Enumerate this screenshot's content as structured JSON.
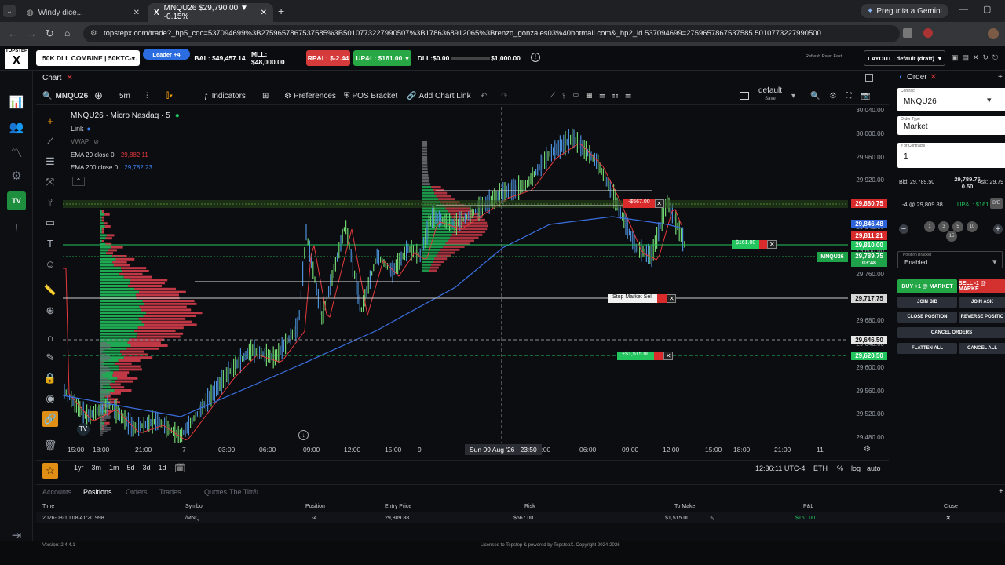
{
  "browser": {
    "tabs": [
      {
        "title": "Windy dice..."
      },
      {
        "title": "MNQU26 $29,790.00 ▼ -0.15%"
      }
    ],
    "gemini": "Pregunta a Gemini",
    "url": "topstepx.com/trade?_hp5_cdc=537094699%3B2759657867537585%3B5010773227990507%3B1786368912065%3Brenzo_gonzales03%40hotmail.com&_hp2_id.537094699=2759657867537585.5010773227990500"
  },
  "app": {
    "logo": "TOPSTEP",
    "account": "50K DLL COMBINE | 50KTC-...",
    "leader": "Leader +4",
    "bal": "BAL: $49,457.14",
    "mll": "MLL: $48,000.00",
    "rpl": "RP&L: $-2.44",
    "upl": "UP&L: $161.00",
    "dll": "DLL:$0.00",
    "dll_max": "$1,000.00",
    "refresh": "Refresh Rate: Fast",
    "layout": "LAYOUT | default (draft)"
  },
  "chart": {
    "panel_title": "Chart",
    "symbol": "MNQU26",
    "interval": "5m",
    "indicators": "Indicators",
    "preferences": "Preferences",
    "pos_bracket": "POS Bracket",
    "add_chart_link": "Add Chart Link",
    "template": "default",
    "template_sub": "Save",
    "legend_title": "MNQU26 · Micro Nasdaq · 5",
    "legend_link": "Link",
    "legend_vwap": "VWAP",
    "ema20_label": "EMA 20 close 0",
    "ema20_value": "29,882.11",
    "ema200_label": "EMA 200 close 0",
    "ema200_value": "29,782.23",
    "price_ticks": [
      "30,040.00",
      "30,000.00",
      "29,960.00",
      "29,920.00",
      "29,880.00",
      "29,840.00",
      "29,800.00",
      "29,760.00",
      "29,720.00",
      "29,680.00",
      "29,640.00",
      "29,600.00",
      "29,560.00",
      "29,520.00",
      "29,480.00"
    ],
    "price_tags": {
      "red": "29,880.75",
      "blue": "29,846.48",
      "red2": "29,811.21",
      "green": "29,810.00",
      "mnq_label": "MNQU26",
      "current": "29,789.75",
      "countdown": "03:48",
      "stop": "29,717.75",
      "crosshair": "29,646.50",
      "target": "29,620.50"
    },
    "time_ticks": [
      "15:00",
      "18:00",
      "21:00",
      "7",
      "03:00",
      "06:00",
      "09:00",
      "12:00",
      "15:00",
      "9",
      "21:",
      "03:00",
      "06:00",
      "09:00",
      "12:00",
      "15:00",
      "18:00",
      "21:00",
      "11"
    ],
    "crosshair_time": "Sun 09 Aug '26   23:50",
    "order_lines": {
      "limit_price": "$161.00",
      "stop_label": "Stop Market Sell",
      "target_label": "+$1,515.00",
      "red_label": "-$567.00"
    },
    "ranges": [
      "1yr",
      "3m",
      "1m",
      "5d",
      "3d",
      "1d"
    ],
    "clock": "12:36:11 UTC-4",
    "session": "ETH",
    "pct": "%",
    "log": "log",
    "auto": "auto"
  },
  "order": {
    "title": "Order",
    "contract_label": "Contract",
    "contract": "MNQU26",
    "order_type_label": "Order Type",
    "order_type": "Market",
    "contracts_label": "# of Contracts",
    "contracts": "1",
    "bid": "Bid: 29,789.50",
    "mid": "29,789.75",
    "spread": "0.50",
    "ask": "Ask: 29,79",
    "position": "-4 @ 29,809.88",
    "upl": "UP&L: $161.00",
    "be": "B/E",
    "qty_buttons": [
      "1",
      "3",
      "5",
      "10",
      "15"
    ],
    "bracket_label": "Position Bracket",
    "bracket": "Enabled",
    "buy": "BUY +1 @ MARKET",
    "sell": "SELL -1 @ MARKE",
    "join_bid": "JOIN BID",
    "join_ask": "JOIN ASK",
    "close_position": "CLOSE POSITION",
    "reverse": "REVERSE POSITIO",
    "cancel_orders": "CANCEL ORDERS",
    "flatten": "FLATTEN ALL",
    "cancel_all": "CANCEL ALL"
  },
  "positions": {
    "tabs": [
      "Accounts",
      "Positions",
      "Orders",
      "Trades",
      "Quotes",
      "The Tilt®"
    ],
    "headers": [
      "Time",
      "Symbol",
      "Position",
      "Entry Price",
      "Risk",
      "To Make",
      "P&L",
      "Close"
    ],
    "row": [
      "2026-08-10 08:41:20.998",
      "/MNQ",
      "-4",
      "29,809.88",
      "$567.00",
      "$1,515.00",
      "$161.00"
    ]
  },
  "footer": {
    "version": "Version: 2.4.4.1",
    "license": "Licensed to Topstep & powered by TopstepX. Copyright 2024-2026"
  },
  "colors": {
    "green": "#22c55e",
    "red": "#e5393e",
    "blue": "#3b82f6",
    "panel": "#0c0d10"
  }
}
